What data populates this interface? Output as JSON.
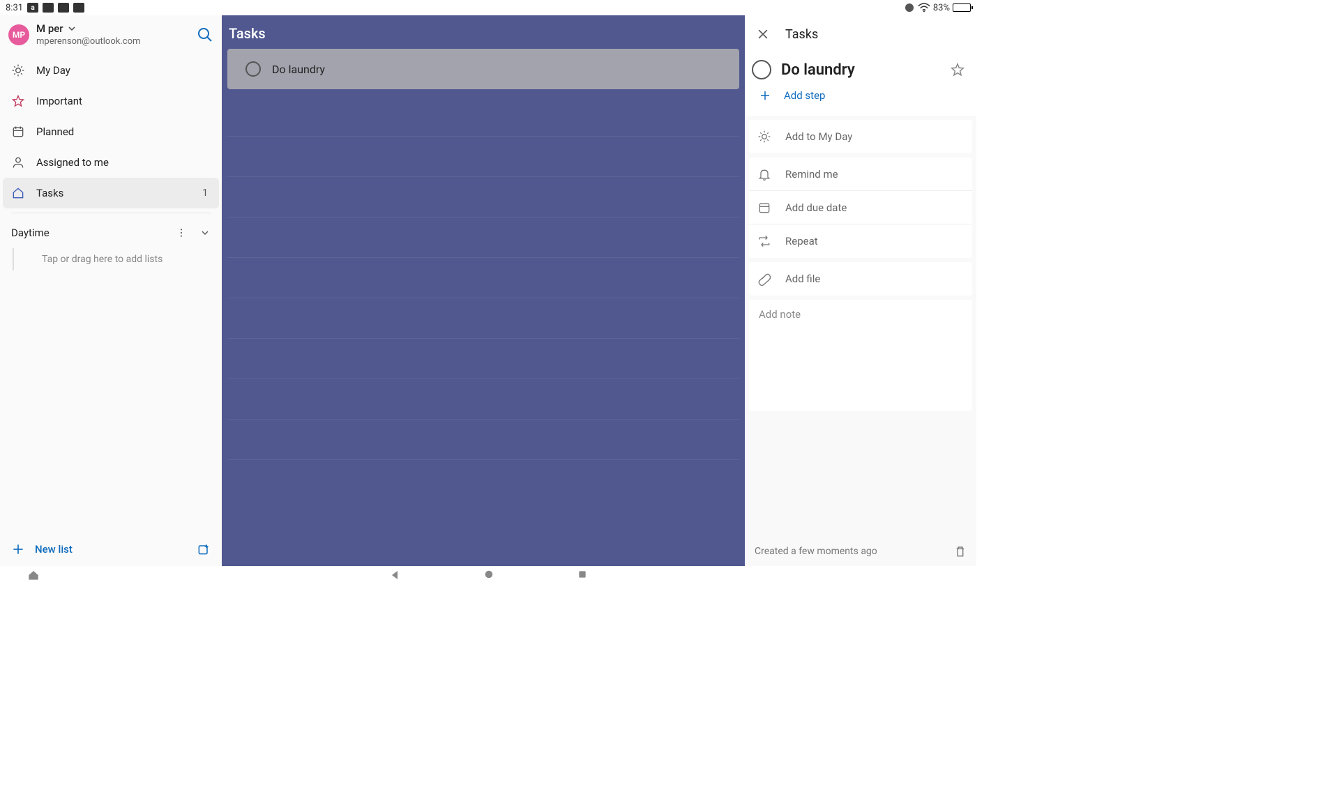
{
  "status": {
    "time": "8:31",
    "battery_pct": "83%"
  },
  "account": {
    "initials": "MP",
    "name": "M per",
    "email": "mperenson@outlook.com"
  },
  "sidebar": {
    "items": [
      {
        "label": "My Day"
      },
      {
        "label": "Important"
      },
      {
        "label": "Planned"
      },
      {
        "label": "Assigned to me"
      },
      {
        "label": "Tasks",
        "count": "1"
      }
    ],
    "group_name": "Daytime",
    "group_hint": "Tap or drag here to add lists",
    "new_list_label": "New list"
  },
  "center": {
    "title": "Tasks",
    "tasks": [
      {
        "title": "Do laundry"
      }
    ]
  },
  "detail": {
    "header_title": "Tasks",
    "task_title": "Do laundry",
    "add_step": "Add step",
    "actions": {
      "my_day": "Add to My Day",
      "remind": "Remind me",
      "due": "Add due date",
      "repeat": "Repeat",
      "file": "Add file"
    },
    "note_placeholder": "Add note",
    "created": "Created a few moments ago"
  }
}
